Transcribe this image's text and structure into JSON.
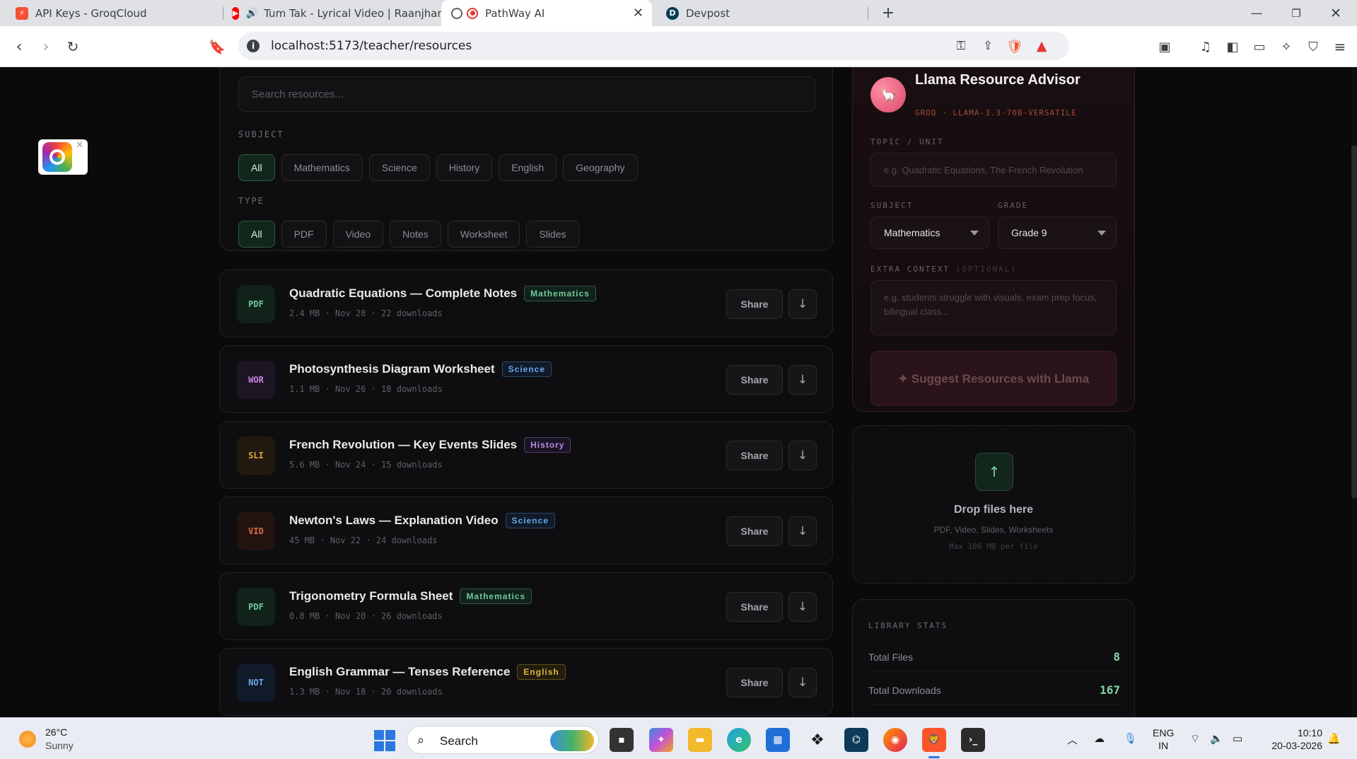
{
  "browser": {
    "tabs": [
      {
        "label": "API Keys - GroqCloud",
        "icon": "groq-icon",
        "color": "#f55036"
      },
      {
        "label": "Tum Tak - Lyrical Video | Raanjhan",
        "icon": "youtube-icon",
        "color": "#ff0000"
      },
      {
        "label": "PathWay AI",
        "icon": "recording-icon",
        "color": "#e53935"
      },
      {
        "label": "Devpost",
        "icon": "devpost-icon",
        "color": "#003e54"
      }
    ],
    "url": "localhost:5173/teacher/resources"
  },
  "filters": {
    "search_placeholder": "Search resources...",
    "subject_label": "SUBJECT",
    "subjects": [
      "All",
      "Mathematics",
      "Science",
      "History",
      "English",
      "Geography"
    ],
    "type_label": "TYPE",
    "types": [
      "All",
      "PDF",
      "Video",
      "Notes",
      "Worksheet",
      "Slides"
    ]
  },
  "resources": [
    {
      "icon_text": "PDF",
      "title": "Quadratic Equations — Complete Notes",
      "subject": "Mathematics",
      "meta": "2.4 MB · Nov 28 · 22 downloads",
      "share": "Share",
      "icon_color": "#6fc99a",
      "icon_bg": "#11221a",
      "badge_color": "#6fc99a",
      "badge_bg": "#11221a"
    },
    {
      "icon_text": "WOR",
      "title": "Photosynthesis Diagram Worksheet",
      "subject": "Science",
      "meta": "1.1 MB · Nov 26 · 18 downloads",
      "share": "Share",
      "icon_color": "#c586e0",
      "icon_bg": "#1d1424",
      "badge_color": "#6aa6e8",
      "badge_bg": "#101a29"
    },
    {
      "icon_text": "SLI",
      "title": "French Revolution — Key Events Slides",
      "subject": "History",
      "meta": "5.6 MB · Nov 24 · 15 downloads",
      "share": "Share",
      "icon_color": "#e0a23c",
      "icon_bg": "#221a0e",
      "badge_color": "#b98ae0",
      "badge_bg": "#1b1426"
    },
    {
      "icon_text": "VID",
      "title": "Newton's Laws — Explanation Video",
      "subject": "Science",
      "meta": "45 MB · Nov 22 · 24 downloads",
      "share": "Share",
      "icon_color": "#e06a4c",
      "icon_bg": "#221310",
      "badge_color": "#6aa6e8",
      "badge_bg": "#101a29"
    },
    {
      "icon_text": "PDF",
      "title": "Trigonometry Formula Sheet",
      "subject": "Mathematics",
      "meta": "0.8 MB · Nov 20 · 26 downloads",
      "share": "Share",
      "icon_color": "#6fc99a",
      "icon_bg": "#11221a",
      "badge_color": "#6fc99a",
      "badge_bg": "#11221a"
    },
    {
      "icon_text": "NOT",
      "title": "English Grammar — Tenses Reference",
      "subject": "English",
      "meta": "1.3 MB · Nov 18 · 20 downloads",
      "share": "Share",
      "icon_color": "#6aa6e8",
      "icon_bg": "#101a29",
      "badge_color": "#e0b43c",
      "badge_bg": "#221c0e"
    }
  ],
  "advisor": {
    "title": "Llama Resource Advisor",
    "subtitle": "GROQ · LLAMA-3.3-70B-VERSATILE",
    "topic_label": "TOPIC / UNIT",
    "topic_placeholder": "e.g. Quadratic Equations, The French Revolution",
    "subject_label": "SUBJECT",
    "subject_value": "Mathematics",
    "grade_label": "GRADE",
    "grade_value": "Grade 9",
    "extra_label": "EXTRA CONTEXT",
    "extra_optional": "(OPTIONAL)",
    "extra_placeholder": "e.g. students struggle with visuals, exam prep focus, bilingual class...",
    "suggest_button": "✦ Suggest Resources with Llama"
  },
  "dropzone": {
    "title": "Drop files here",
    "formats": "PDF, Video, Slides, Worksheets",
    "max": "Max 100 MB per file"
  },
  "stats": {
    "label": "LIBRARY STATS",
    "rows": [
      {
        "key": "Total Files",
        "value": "8"
      },
      {
        "key": "Total Downloads",
        "value": "167"
      }
    ]
  },
  "taskbar": {
    "temperature": "26°C",
    "weather": "Sunny",
    "search_label": "Search",
    "lang_top": "ENG",
    "lang_bottom": "IN",
    "time": "10:10",
    "date": "20-03-2026"
  }
}
